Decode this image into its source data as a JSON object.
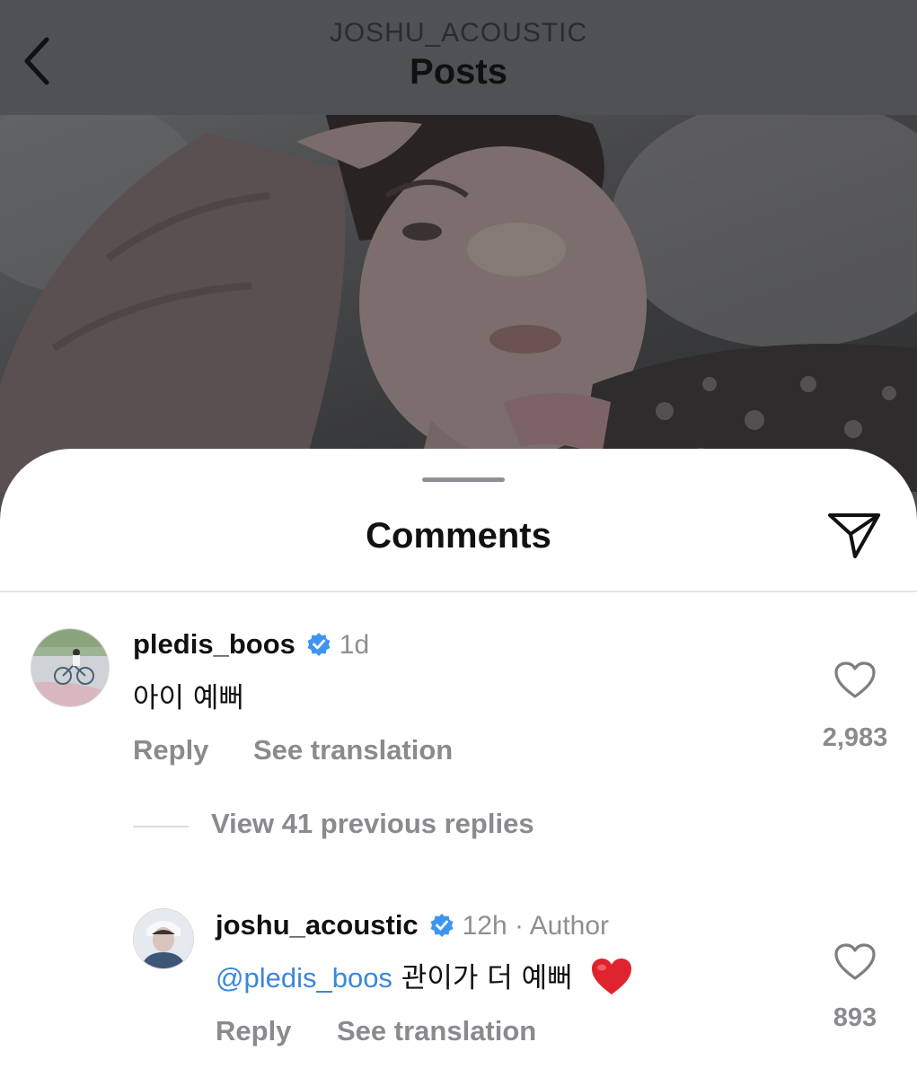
{
  "header": {
    "account": "JOSHU_ACOUSTIC",
    "title": "Posts"
  },
  "sheet": {
    "title": "Comments"
  },
  "comments": [
    {
      "username": "pledis_boos",
      "verified": true,
      "time": "1d",
      "text": "아이 예뻐",
      "reply_label": "Reply",
      "translate_label": "See translation",
      "likes": "2,983"
    }
  ],
  "view_replies": "View 41 previous replies",
  "reply": {
    "username": "joshu_acoustic",
    "verified": true,
    "time": "12h · Author",
    "mention": "@pledis_boos",
    "text": "관이가 더 예뻐",
    "reply_label": "Reply",
    "translate_label": "See translation",
    "likes": "893"
  },
  "colors": {
    "verified": "#3d95f0",
    "mention": "#3b87d8",
    "heart_emoji": "#e0242f"
  }
}
